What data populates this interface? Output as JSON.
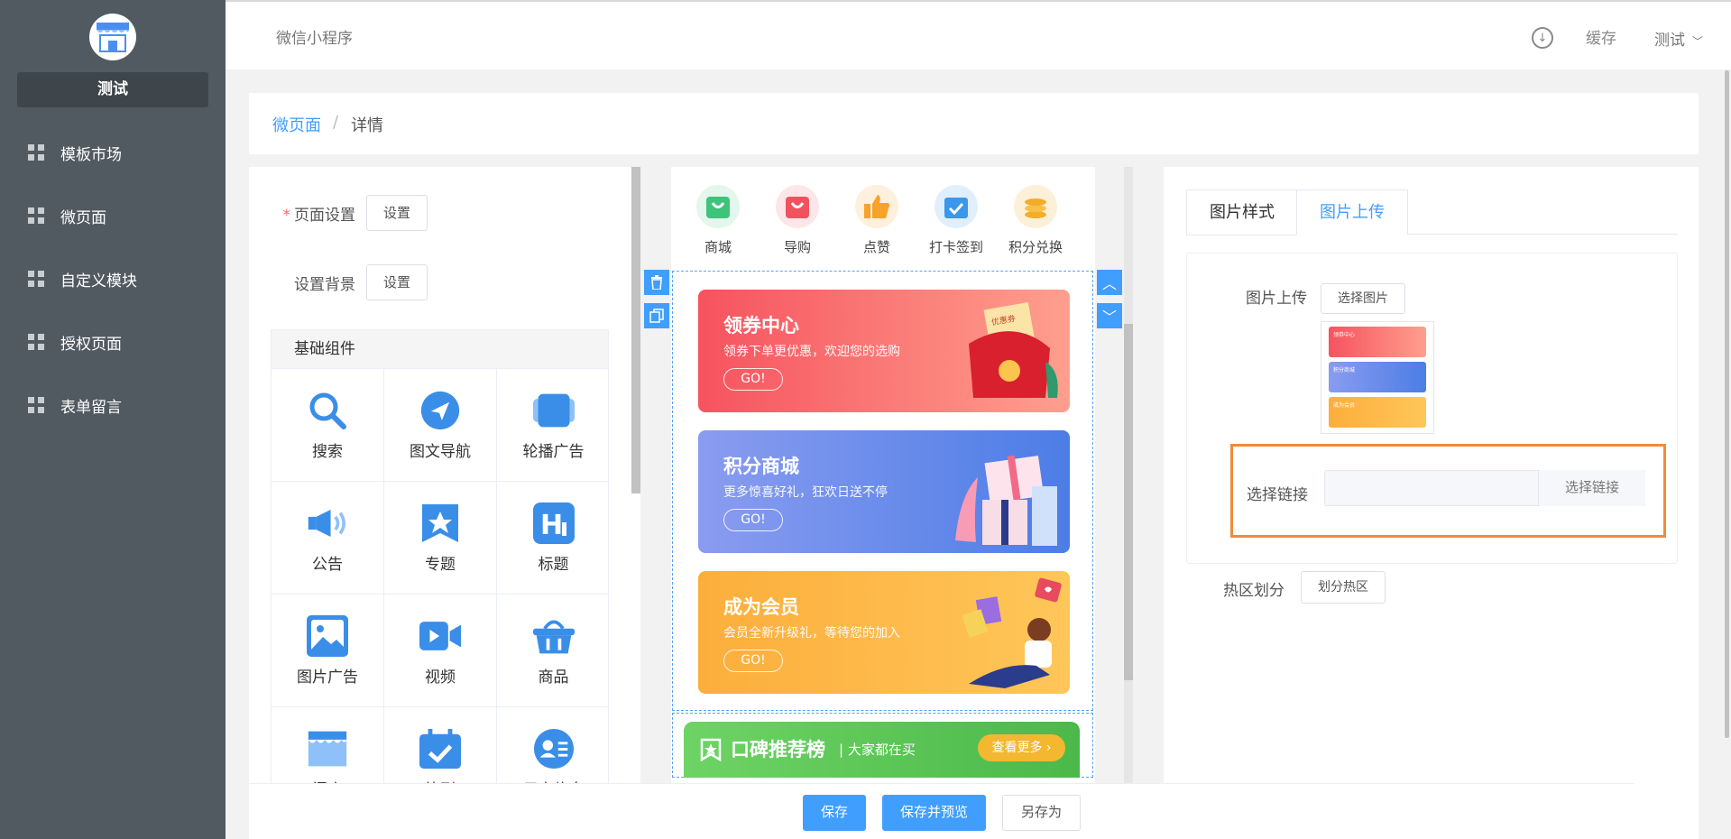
{
  "sidebar": {
    "shop_name": "测试",
    "items": [
      {
        "label": "模板市场"
      },
      {
        "label": "微页面"
      },
      {
        "label": "自定义模块"
      },
      {
        "label": "授权页面"
      },
      {
        "label": "表单留言"
      }
    ]
  },
  "topbar": {
    "app_tab": "微信小程序",
    "cache": "缓存",
    "user": "测试"
  },
  "breadcrumb": {
    "link": "微页面",
    "separator": "/",
    "current": "详情"
  },
  "settings": {
    "page_label": "页面设置",
    "page_required": "*",
    "page_button": "设置",
    "bg_label": "设置背景",
    "bg_button": "设置"
  },
  "components": {
    "title": "基础组件",
    "items": [
      {
        "label": "搜索",
        "icon": "search-icon"
      },
      {
        "label": "图文导航",
        "icon": "navigation-icon"
      },
      {
        "label": "轮播广告",
        "icon": "carousel-icon"
      },
      {
        "label": "公告",
        "icon": "megaphone-icon"
      },
      {
        "label": "专题",
        "icon": "bookmark-star-icon"
      },
      {
        "label": "标题",
        "icon": "heading-icon"
      },
      {
        "label": "图片广告",
        "icon": "image-icon"
      },
      {
        "label": "视频",
        "icon": "video-icon"
      },
      {
        "label": "商品",
        "icon": "basket-icon"
      },
      {
        "label": "门店",
        "icon": "store-icon"
      },
      {
        "label": "签到",
        "icon": "calendar-check-icon"
      },
      {
        "label": "用户信息",
        "icon": "user-card-icon"
      }
    ]
  },
  "preview": {
    "nav": [
      {
        "label": "商城",
        "color": "#3ec37a"
      },
      {
        "label": "导购",
        "color": "#f0535f"
      },
      {
        "label": "点赞",
        "color": "#f7a22a"
      },
      {
        "label": "打卡签到",
        "color": "#3a97ea"
      },
      {
        "label": "积分兑换",
        "color": "#f4ad27"
      }
    ],
    "banners": [
      {
        "title": "领券中心",
        "sub": "领券下单更优惠，欢迎您的选购",
        "go": "GO!",
        "badge": "优惠券"
      },
      {
        "title": "积分商城",
        "sub": "更多惊喜好礼，狂欢日送不停",
        "go": "GO!"
      },
      {
        "title": "成为会员",
        "sub": "会员全新升级礼，等待您的加入",
        "go": "GO!"
      }
    ],
    "rank": {
      "title": "口碑推荐榜",
      "sub": "大家都在买",
      "more": "查看更多"
    }
  },
  "right": {
    "tabs": [
      "图片样式",
      "图片上传"
    ],
    "upload_label": "图片上传",
    "select_image": "选择图片",
    "link_label": "选择链接",
    "link_placeholder": "",
    "link_button": "选择链接",
    "hotzone_label": "热区划分",
    "hotzone_button": "划分热区",
    "thumb_titles": [
      "领券中心",
      "积分商城",
      "成为会员"
    ]
  },
  "footer": {
    "save": "保存",
    "save_preview": "保存并预览",
    "save_as": "另存为"
  },
  "colors": {
    "accent": "#409eff",
    "sidebar": "#525a61",
    "highlight": "#f08b3a"
  }
}
